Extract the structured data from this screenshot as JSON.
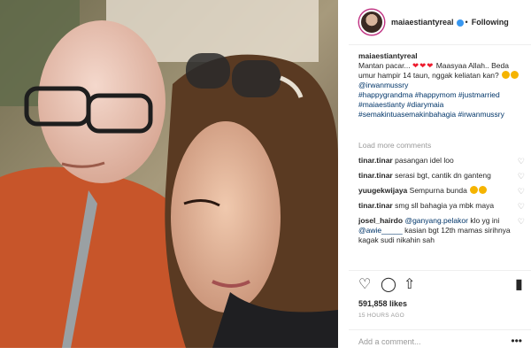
{
  "header": {
    "username": "maiaestiantyreal",
    "separator": "•",
    "follow_label": "Following"
  },
  "caption": {
    "username": "maiaestiantyreal",
    "line1": "Mantan pacar...",
    "hearts": "❤❤❤",
    "line1_end": "Maasyaa Allah..",
    "line2": "Beda umur hampir 14 taun, nggak keliatan kan?",
    "hashtags": [
      "@irwanmussry",
      "#happygrandma #happymom #justmarried",
      "#maiaestianty #diarymaia",
      "#semakintuasemakinbahagia #irwanmussry"
    ]
  },
  "load_more": "Load more comments",
  "comments": [
    {
      "user": "tinar.tinar",
      "text": "pasangan idel loo"
    },
    {
      "user": "tinar.tinar",
      "text": "serasi bgt, cantik dn ganteng"
    },
    {
      "user": "yuugekwijaya",
      "text": "Sempurna bunda"
    },
    {
      "user": "tinar.tinar",
      "text": "smg sll bahagia ya mbk maya"
    },
    {
      "user": "josel_hairdo",
      "mention1": "@ganyang.pelakor",
      "text1": "klo yg ini",
      "mention2": "@awie_____",
      "text2": "kasian bgt 12th mamas sirihnya kagak sudi nikahin sah"
    }
  ],
  "likes": "591,858 likes",
  "time": "15 HOURS AGO",
  "add_comment_placeholder": "Add a comment...",
  "more_icon": "•••",
  "icons": {
    "heart": "heart-icon",
    "comment": "comment-icon",
    "share": "share-icon",
    "bookmark": "bookmark-icon"
  },
  "colors": {
    "link": "#003569",
    "verified": "#3897f0",
    "heart": "#ed1c2e"
  }
}
